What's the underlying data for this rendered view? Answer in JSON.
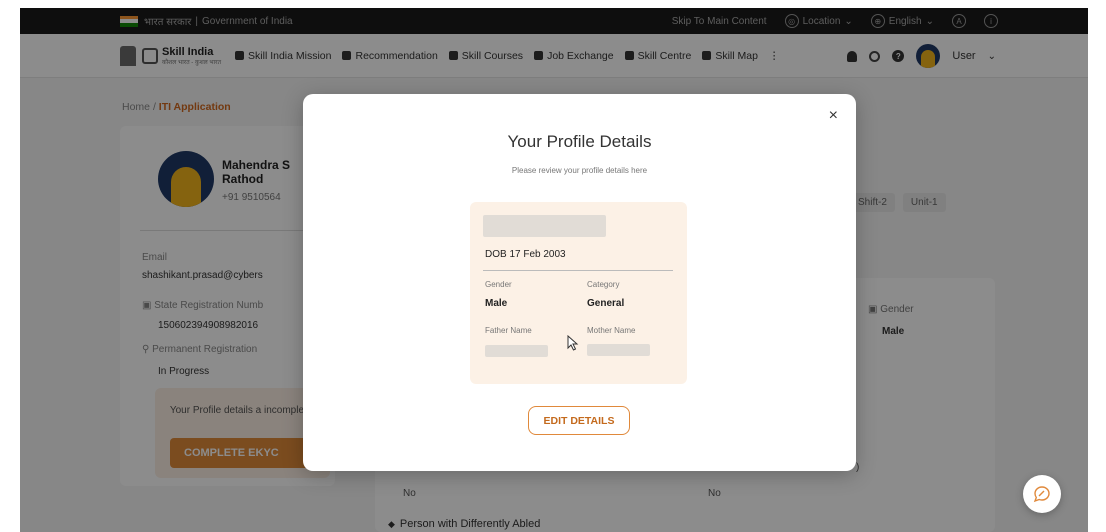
{
  "gov_bar": {
    "hindi_text": "भारत सरकार",
    "gov_text": "Government of India",
    "skip_link": "Skip To Main Content",
    "location": "Location",
    "language": "English",
    "text_size": "A",
    "flag_colors": [
      "#FF9933",
      "#FFFFFF",
      "#138808"
    ]
  },
  "nav": {
    "logo_title": "Skill India",
    "logo_subtitle": "कौशल भारत - कुशल भारत",
    "items": [
      {
        "label": "Skill India Mission",
        "icon": "gear-icon"
      },
      {
        "label": "Recommendation",
        "icon": "card-icon"
      },
      {
        "label": "Skill Courses",
        "icon": "graduation-cap-icon"
      },
      {
        "label": "Job Exchange",
        "icon": "briefcase-icon"
      },
      {
        "label": "Skill Centre",
        "icon": "location-pin-icon"
      },
      {
        "label": "Skill Map",
        "icon": "map-icon"
      }
    ],
    "user_label": "User"
  },
  "page": {
    "breadcrumb_home": "Home",
    "breadcrumb_sep": "/",
    "breadcrumb_current": "ITI Application",
    "profile_name_line1": "Mahendra S",
    "profile_name_line2": "Rathod",
    "profile_phone": "+91 9510564",
    "email_label": "Email",
    "email_value": "shashikant.prasad@cybers",
    "state_reg_label": "State Registration Numb",
    "state_reg_value": "150602394908982016",
    "perm_reg_label": "Permanent Registration",
    "perm_reg_value": "In Progress",
    "profile_warning": "Your Profile details a incomplete!",
    "complete_ekyc": "COMPLETE EKYC",
    "tag_shift": "Shift-2",
    "tag_unit": "Unit-1",
    "gender_label": "Gender",
    "gender_value": "Male",
    "answer_no_1": "No",
    "answer_no_2": "No",
    "paren_text": ")",
    "differently_abled": "Person with Differently Abled"
  },
  "modal": {
    "title": "Your Profile Details",
    "subtitle": "Please review your profile details here",
    "dob": "DOB 17 Feb 2003",
    "gender_label": "Gender",
    "gender_value": "Male",
    "category_label": "Category",
    "category_value": "General",
    "father_label": "Father Name",
    "mother_label": "Mother Name",
    "edit_button": "EDIT DETAILS",
    "close_symbol": "×"
  },
  "colors": {
    "accent": "#E0893B",
    "card_bg": "#FCF1E6",
    "dark_bar": "#1A1A1A"
  }
}
